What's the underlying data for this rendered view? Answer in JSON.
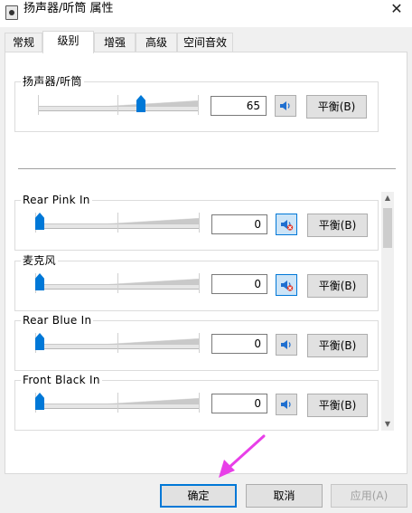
{
  "window": {
    "title": "扬声器/听筒 属性",
    "close_glyph": "✕"
  },
  "tabs": [
    "常规",
    "级别",
    "增强",
    "高级",
    "空间音效"
  ],
  "active_tab": 1,
  "master": {
    "label": "扬声器/听筒",
    "value": "65",
    "level": 65,
    "muted": false,
    "balance_label": "平衡(B)"
  },
  "devices": [
    {
      "label": "Rear Pink In",
      "value": "0",
      "level": 0,
      "muted": true,
      "balance_label": "平衡(B)"
    },
    {
      "label": "麦克风",
      "value": "0",
      "level": 0,
      "muted": true,
      "balance_label": "平衡(B)"
    },
    {
      "label": "Rear Blue In",
      "value": "0",
      "level": 0,
      "muted": false,
      "balance_label": "平衡(B)"
    },
    {
      "label": "Front Black In",
      "value": "0",
      "level": 0,
      "muted": false,
      "balance_label": "平衡(B)"
    }
  ],
  "footer": {
    "ok": "确定",
    "cancel": "取消",
    "apply": "应用(A)"
  },
  "colors": {
    "accent": "#0078d7",
    "annotation_arrow": "#e83fe8"
  },
  "icons": {
    "speaker": "speaker-icon",
    "muted": "speaker-muted-icon"
  }
}
